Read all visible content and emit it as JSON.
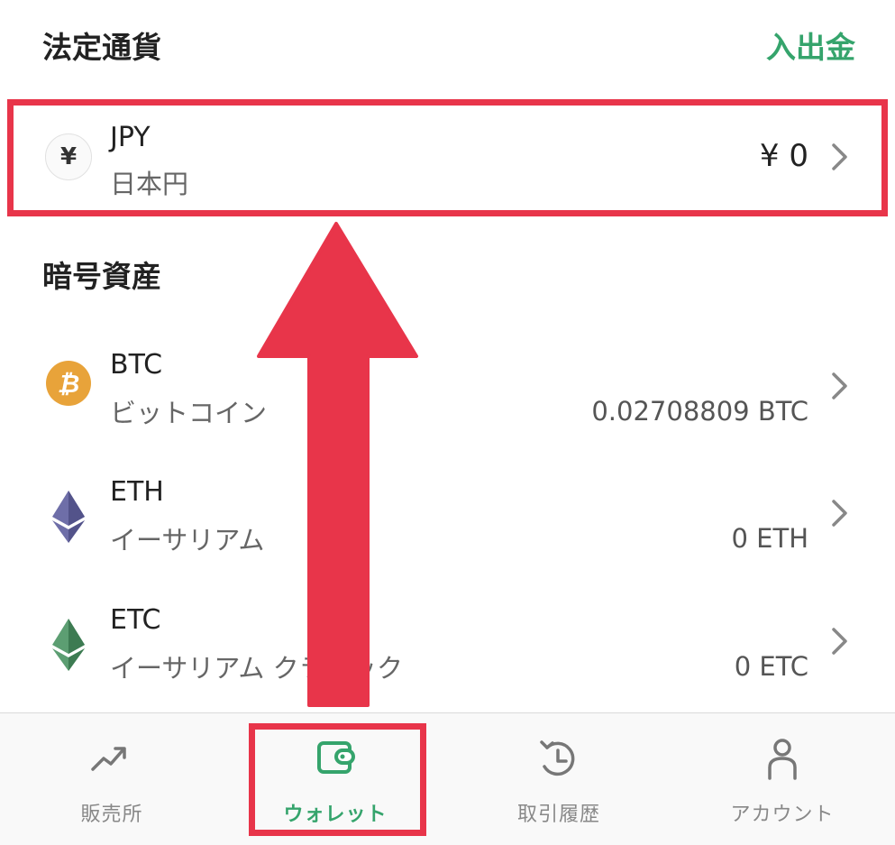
{
  "fiat": {
    "section_title": "法定通貨",
    "deposit_link": "入出金",
    "jpy": {
      "icon_glyph": "¥",
      "symbol": "JPY",
      "name": "日本円",
      "amount": "¥ 0"
    }
  },
  "crypto": {
    "section_title": "暗号資産",
    "assets": [
      {
        "symbol": "BTC",
        "name": "ビットコイン",
        "amount": "0.02708809 BTC",
        "icon": "bitcoin-icon"
      },
      {
        "symbol": "ETH",
        "name": "イーサリアム",
        "amount": "0 ETH",
        "icon": "ethereum-icon"
      },
      {
        "symbol": "ETC",
        "name": "イーサリアム クラシック",
        "amount": "0 ETC",
        "icon": "ethereum-classic-icon"
      }
    ]
  },
  "tabbar": {
    "tabs": [
      {
        "label": "販売所",
        "icon": "trend-chart-icon",
        "active": false
      },
      {
        "label": "ウォレット",
        "icon": "wallet-icon",
        "active": true
      },
      {
        "label": "取引履歴",
        "icon": "history-icon",
        "active": false
      },
      {
        "label": "アカウント",
        "icon": "user-icon",
        "active": false
      }
    ]
  },
  "colors": {
    "accent_green": "#35a46c",
    "highlight_red": "#e8354a",
    "bitcoin_orange": "#e8a33a"
  }
}
